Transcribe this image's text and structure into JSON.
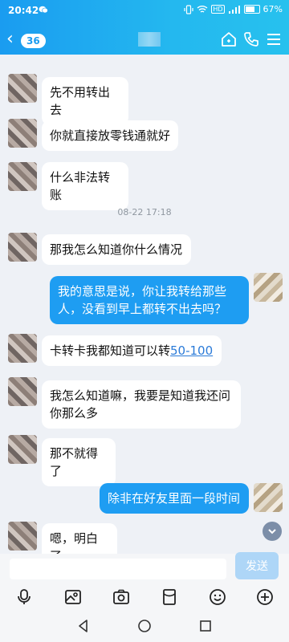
{
  "status_bar": {
    "time": "20:42",
    "network_tag": "HD",
    "battery": "67%"
  },
  "header": {
    "back_symbol": "‹",
    "unread_count": "36"
  },
  "messages": [
    {
      "side": "in",
      "text": "先不用转出去"
    },
    {
      "side": "in",
      "text": "你就直接放零钱通就好"
    },
    {
      "side": "in",
      "text": "什么非法转账"
    },
    {
      "side": "in",
      "text": "那我怎么知道你什么情况"
    },
    {
      "side": "out",
      "text": "我的意思是说，你让我转给那些人，没看到早上都转不出去吗？"
    },
    {
      "side": "in",
      "text_before_link": "卡转卡我都知道可以转",
      "link_text": "50-100"
    },
    {
      "side": "in",
      "text": "我怎么知道嘛，我要是知道我还问你那么多"
    },
    {
      "side": "in",
      "text": "那不就得了"
    },
    {
      "side": "out",
      "text": "除非在好友里面一段时间"
    },
    {
      "side": "in",
      "text": "嗯，明白了"
    }
  ],
  "timestamp": "08-22 17:18",
  "composer": {
    "send_label": "发送"
  },
  "icons": {
    "toolbar": [
      "voice-icon",
      "image-icon",
      "camera-icon",
      "red-packet-icon",
      "emoji-icon",
      "plus-icon"
    ],
    "header": [
      "home-icon",
      "phone-icon",
      "menu-icon"
    ]
  },
  "colors": {
    "header": "#1a9cf0",
    "outgoing_bubble": "#1e9df2",
    "incoming_bubble": "#ffffff"
  }
}
